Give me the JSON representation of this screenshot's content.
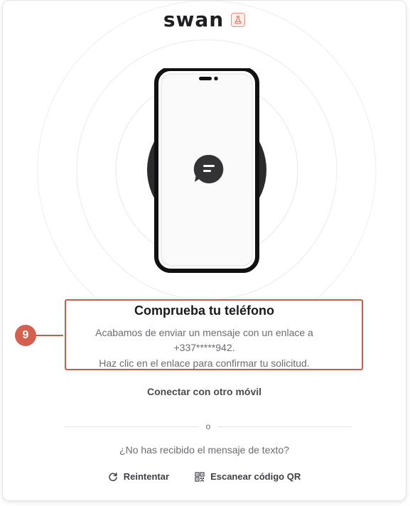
{
  "brand": {
    "name": "swan",
    "sandbox_icon": "flask-icon",
    "sandbox_color": "#e7907f"
  },
  "illustration": {
    "icons": [
      "smartphone-icon",
      "chat-bubble-icon"
    ],
    "ring_color": "#ececec",
    "phone_color": "#111111"
  },
  "verification": {
    "title": "Comprueba tu teléfono",
    "line1": "Acabamos de enviar un mensaje con un enlace a",
    "phone": "+337*****942.",
    "line3": "Haz clic en el enlace para confirmar tu solicitud."
  },
  "annotation": {
    "number": "9",
    "color": "#cd5a4c"
  },
  "links": {
    "other_phone": "Conectar con otro móvil"
  },
  "divider": {
    "or": "o"
  },
  "no_sms": {
    "question": "¿No has recibido el mensaje de texto?",
    "retry_label": "Reintentar",
    "retry_icon": "refresh-icon",
    "qr_label": "Escanear código QR",
    "qr_icon": "qr-code-icon"
  }
}
